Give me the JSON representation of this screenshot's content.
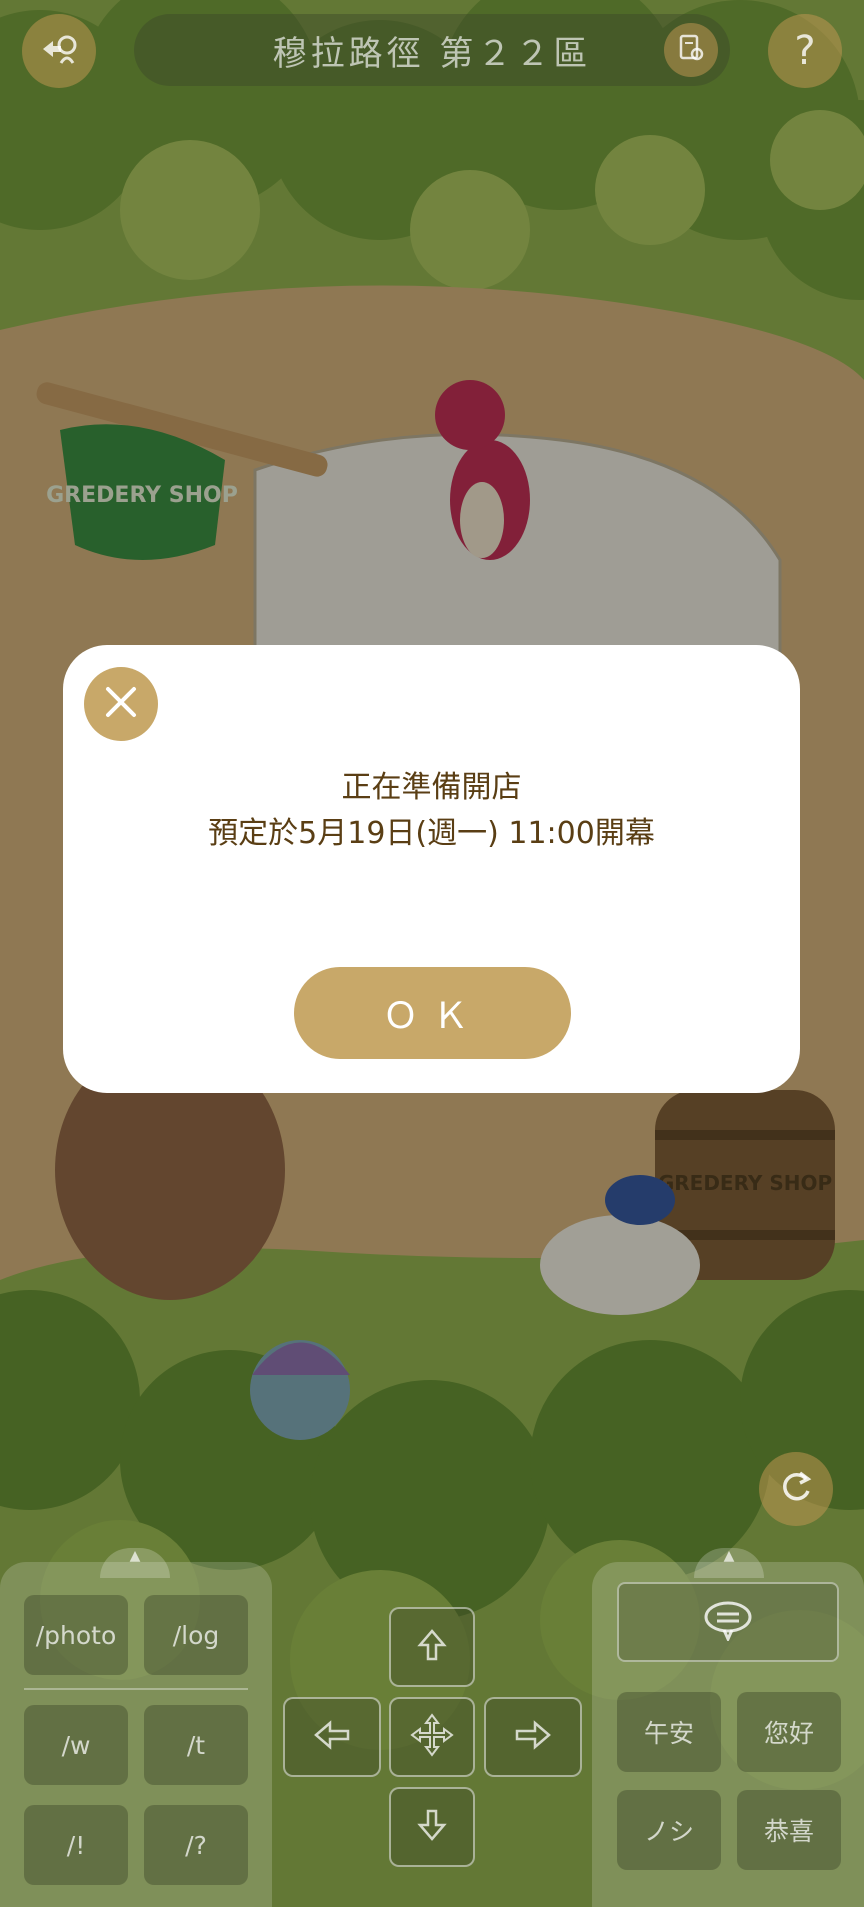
{
  "header": {
    "title": "穆拉路徑 第２２區"
  },
  "icons": {
    "back": "exit-map-icon",
    "notes": "document-pin-icon",
    "help": "question-mark-icon",
    "close": "close-x-icon",
    "refresh": "refresh-icon",
    "chat": "speech-bubble-icon"
  },
  "scene": {
    "shop_sign": "GREDERY SHOP",
    "barrel_text": "GREDERY SHOP"
  },
  "dialog": {
    "line1": "正在準備開店",
    "line2": "預定於5月19日(週一) 11:00開幕",
    "ok_label": "ＯＫ"
  },
  "commands": {
    "photo": "/photo",
    "log": "/log",
    "w": "/w",
    "t": "/t",
    "excl": "/!",
    "question": "/?"
  },
  "quick_phrases": {
    "afternoon": "午安",
    "hello": "您好",
    "nosi": "ノシ",
    "congrats": "恭喜"
  },
  "colors": {
    "accent": "#c8a869",
    "dialog_text": "#5a3e14"
  }
}
